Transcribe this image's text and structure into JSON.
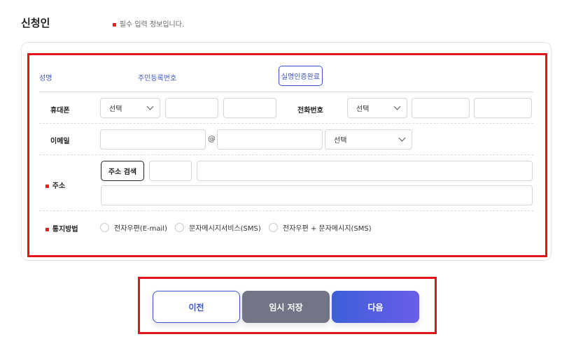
{
  "page": {
    "title": "신청인",
    "required_note": "필수 입력 정보입니다."
  },
  "header_row": {
    "name_label": "성명",
    "resident_label": "주민등록번호",
    "verified_button": "실명인증완료"
  },
  "mobile": {
    "label": "휴대폰",
    "select_value": "선택"
  },
  "phone": {
    "label": "전화번호",
    "select_value": "선택"
  },
  "email": {
    "label": "이메일",
    "at": "@",
    "domain_select_value": "선택"
  },
  "address": {
    "label": "주소",
    "search_button": "주소 검색"
  },
  "notify": {
    "label": "통지방법",
    "options": [
      "전자우편(E-mail)",
      "문자메시지서비스(SMS)",
      "전자우편 + 문자메시지(SMS)"
    ]
  },
  "actions": {
    "prev": "이전",
    "temp_save": "임시 저장",
    "next": "다음"
  },
  "colors": {
    "accent": "#3a55c9",
    "required_marker": "#e02020",
    "highlight_box": "#e3141b",
    "temp_save_bg": "#737587"
  }
}
